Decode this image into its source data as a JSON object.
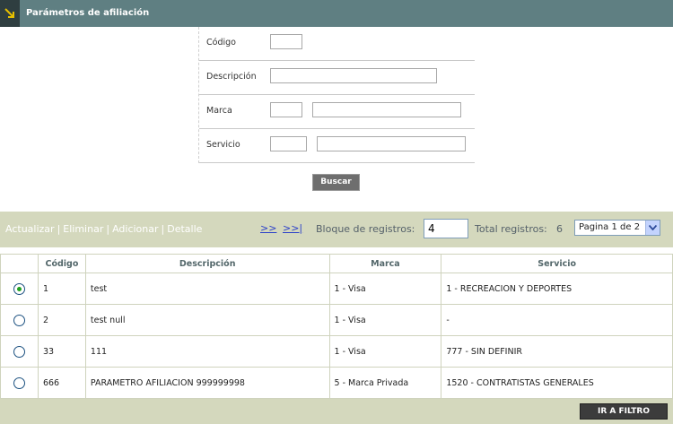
{
  "header": {
    "title": "Parámetros de afiliación",
    "icon": "arrow-down-right-icon"
  },
  "form": {
    "codigo_label": "Código",
    "descripcion_label": "Descripción",
    "marca_label": "Marca",
    "servicio_label": "Servicio",
    "codigo_value": "",
    "descripcion_value": "",
    "marca_code_value": "",
    "marca_name_value": "",
    "servicio_code_value": "",
    "servicio_name_value": "",
    "buscar_label": "Buscar"
  },
  "toolbar": {
    "actualizar": "Actualizar",
    "eliminar": "Eliminar",
    "adicionar": "Adicionar",
    "detalle": "Detalle",
    "next": ">>",
    "last": ">>|",
    "bloque_label": "Bloque de registros:",
    "bloque_value": "4",
    "total_label": "Total registros:",
    "total_value": "6",
    "page_select": "Pagina 1 de 2"
  },
  "table": {
    "headers": [
      "",
      "Código",
      "Descripción",
      "Marca",
      "Servicio"
    ],
    "rows": [
      {
        "selected": true,
        "codigo": "1",
        "descripcion": "test",
        "marca": "1 - Visa",
        "servicio": "1 - RECREACION Y DEPORTES"
      },
      {
        "selected": false,
        "codigo": "2",
        "descripcion": "test null",
        "marca": "1 - Visa",
        "servicio": "-"
      },
      {
        "selected": false,
        "codigo": "33",
        "descripcion": "111",
        "marca": "1 - Visa",
        "servicio": "777 - SIN DEFINIR"
      },
      {
        "selected": false,
        "codigo": "666",
        "descripcion": "PARAMETRO AFILIACION 999999998",
        "marca": "5 - Marca Privada",
        "servicio": "1520 - CONTRATISTAS GENERALES"
      }
    ]
  },
  "footer": {
    "ir_filtro": "IR A FILTRO"
  },
  "colors": {
    "header_bg": "#5f7f82",
    "toolbar_bg": "#d4d8bd",
    "accent_yellow": "#e8c000"
  }
}
